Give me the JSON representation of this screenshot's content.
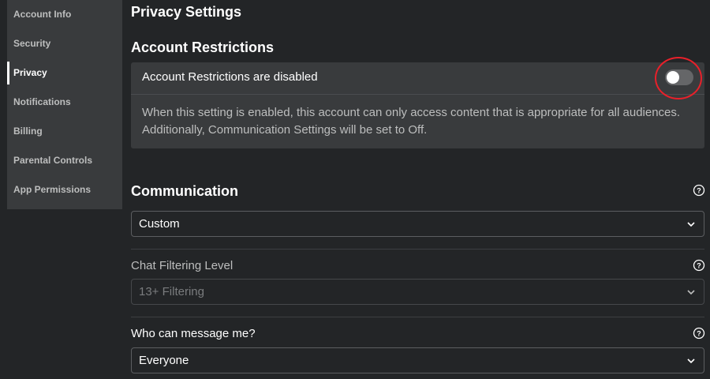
{
  "sidebar": {
    "items": [
      {
        "label": "Account Info"
      },
      {
        "label": "Security"
      },
      {
        "label": "Privacy"
      },
      {
        "label": "Notifications"
      },
      {
        "label": "Billing"
      },
      {
        "label": "Parental Controls"
      },
      {
        "label": "App Permissions"
      }
    ],
    "active_item": "Privacy"
  },
  "page": {
    "title": "Privacy Settings"
  },
  "account_restrictions": {
    "heading": "Account Restrictions",
    "status_label": "Account Restrictions are disabled",
    "toggle_on": false,
    "description": "When this setting is enabled, this account can only access content that is appropriate for all audiences. Additionally, Communication Settings will be set to Off.",
    "highlight_color": "#e8202a"
  },
  "communication": {
    "heading": "Communication",
    "preset_value": "Custom",
    "chat_filtering": {
      "label": "Chat Filtering Level",
      "value": "13+ Filtering",
      "disabled": true
    },
    "message_me": {
      "label": "Who can message me?",
      "value": "Everyone"
    }
  },
  "icons": {
    "help": "help-icon",
    "dropdown": "chevron-down-icon"
  },
  "colors": {
    "background": "#232527",
    "panel": "#393b3d",
    "text": "#ffffff",
    "muted_text": "#bdbebe"
  }
}
